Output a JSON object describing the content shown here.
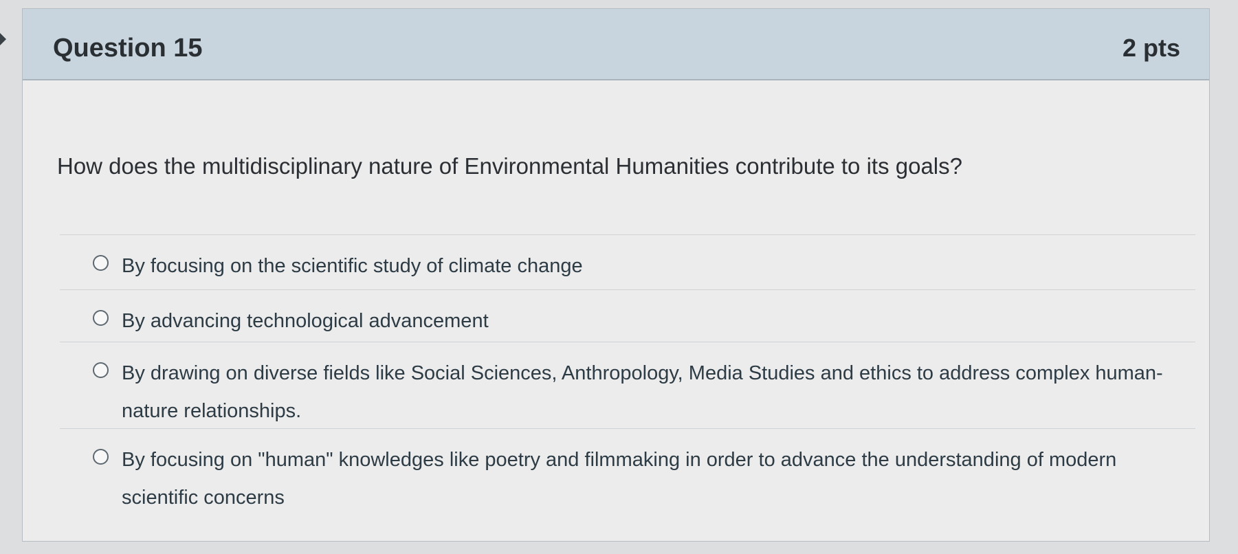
{
  "question": {
    "title": "Question 15",
    "points": "2 pts",
    "text": "How does the multidisciplinary nature of Environmental Humanities contribute to its goals?"
  },
  "answers": [
    {
      "label": "By focusing on the scientiﬁc study of climate change",
      "selected": false
    },
    {
      "label": "By advancing technological advancement",
      "selected": false
    },
    {
      "label": "By drawing on diverse ﬁelds like Social Sciences, Anthropology, Media Studies and ethics to address complex human-nature relationships.",
      "selected": false
    },
    {
      "label": "By focusing on \"human\" knowledges like poetry and ﬁlmmaking in order to advance the understanding of modern scientiﬁc concerns",
      "selected": false
    }
  ],
  "icons": {
    "collapse": "caret-right-icon"
  }
}
